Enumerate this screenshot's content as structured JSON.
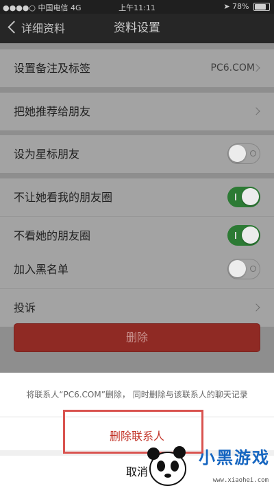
{
  "status_bar": {
    "carrier": "中国电信",
    "network": "4G",
    "time": "上午11:11",
    "battery": "78%",
    "battery_fill": 0.78
  },
  "nav": {
    "back_label": "详细资料",
    "title": "资料设置"
  },
  "groups": [
    {
      "rows": [
        {
          "label": "设置备注及标签",
          "value": "PC6.COM",
          "control": "arrow"
        }
      ]
    },
    {
      "rows": [
        {
          "label": "把她推荐给朋友",
          "control": "arrow"
        }
      ]
    },
    {
      "rows": [
        {
          "label": "设为星标朋友",
          "control": "toggle",
          "state": "off"
        }
      ]
    },
    {
      "rows": [
        {
          "label": "不让她看我的朋友圈",
          "control": "toggle",
          "state": "on"
        },
        {
          "label": "不看她的朋友圈",
          "control": "toggle",
          "state": "on"
        }
      ]
    },
    {
      "rows": [
        {
          "label": "加入黑名单",
          "control": "toggle",
          "state": "off"
        },
        {
          "label": "投诉",
          "control": "arrow"
        }
      ]
    }
  ],
  "delete_button": "删除",
  "action_sheet": {
    "message": "将联系人“PC6.COM”删除， 同时删除与该联系人的聊天记录",
    "confirm": "删除联系人",
    "cancel": "取消"
  },
  "watermark": {
    "text": "小黑游戏",
    "url": "www.xiaohei.com"
  },
  "colors": {
    "toggle_on": "#2c7a34",
    "danger": "#c3362b",
    "highlight": "#d9534f"
  }
}
